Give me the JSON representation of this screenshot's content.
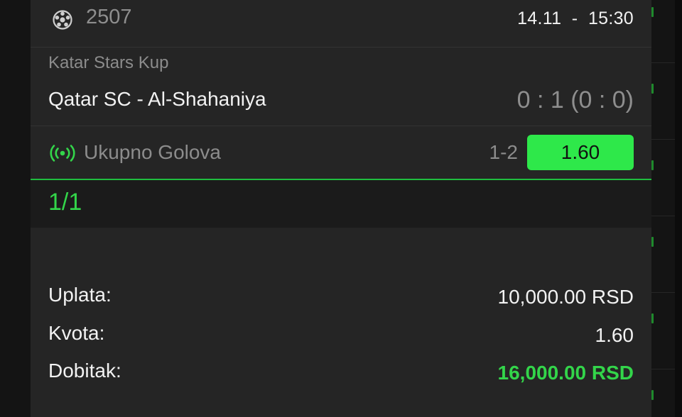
{
  "ticket": {
    "sport_icon": "soccer-ball-icon",
    "id": "2507",
    "date": "14.11",
    "separator": "-",
    "time": "15:30"
  },
  "match": {
    "league": "Katar Stars Kup",
    "teams": "Qatar SC - Al-Shahaniya",
    "score": "0 : 1 (0 : 0)"
  },
  "bet": {
    "live_icon": "live-broadcast-icon",
    "market": "Ukupno Golova",
    "pick": "1-2",
    "odd": "1.60"
  },
  "combo": "1/1",
  "summary": {
    "stake_label": "Uplata:",
    "stake_value": "10,000.00 RSD",
    "odds_label": "Kvota:",
    "odds_value": "1.60",
    "win_label": "Dobitak:",
    "win_value": "16,000.00 RSD"
  },
  "colors": {
    "accent_green": "#2ee84a",
    "win_green": "#33d54a",
    "card_bg": "#252525"
  }
}
